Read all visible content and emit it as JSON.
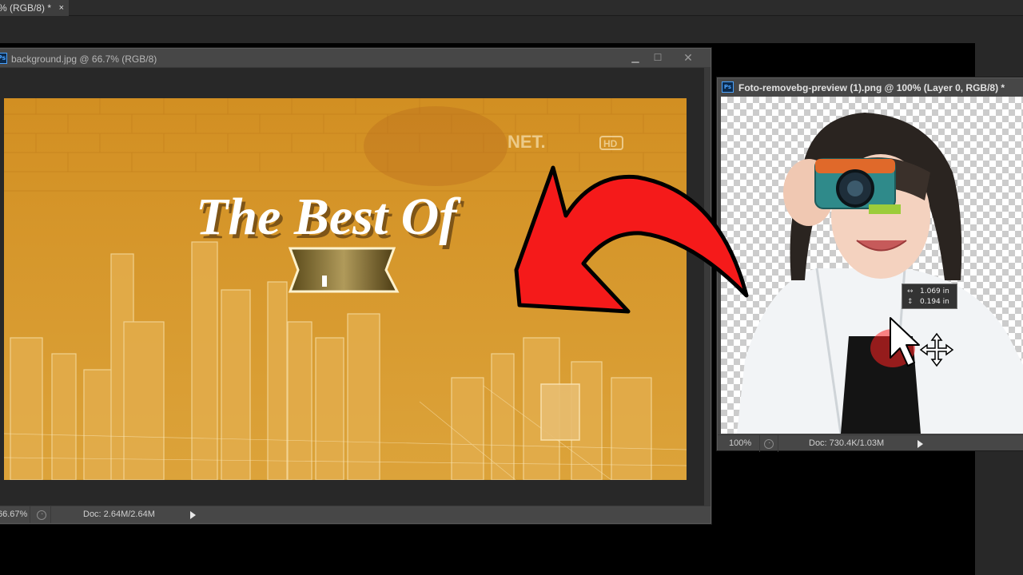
{
  "top_tab": {
    "label": "% (RGB/8) *",
    "close": "×"
  },
  "window1": {
    "title": "background.jpg @ 66.7% (RGB/8)",
    "badge": "Ps",
    "controls": {
      "minimize": "▁",
      "maximize": "☐",
      "close": "✕"
    },
    "image_text": {
      "headline": "The Best Of",
      "channel": "NET.",
      "hd": "HD"
    },
    "status": {
      "zoom": "66.67%",
      "doc": "Doc: 2.64M/2.64M"
    }
  },
  "window2": {
    "title": "Foto-removebg-preview (1).png @ 100% (Layer 0, RGB/8) *",
    "badge": "Ps",
    "status": {
      "zoom": "100%",
      "doc": "Doc: 730.4K/1.03M"
    }
  },
  "move_tooltip": {
    "dx": "1.069 in",
    "dy": "0.194 in"
  },
  "colors": {
    "arrow": "#f51a1a",
    "canvas_orange": "#d89a2a",
    "panel": "#474747"
  },
  "icons": [
    "close-icon",
    "minimize-icon",
    "maximize-icon",
    "move-cursor-icon",
    "arrow-pointer-icon",
    "status-menu-arrow-icon"
  ]
}
